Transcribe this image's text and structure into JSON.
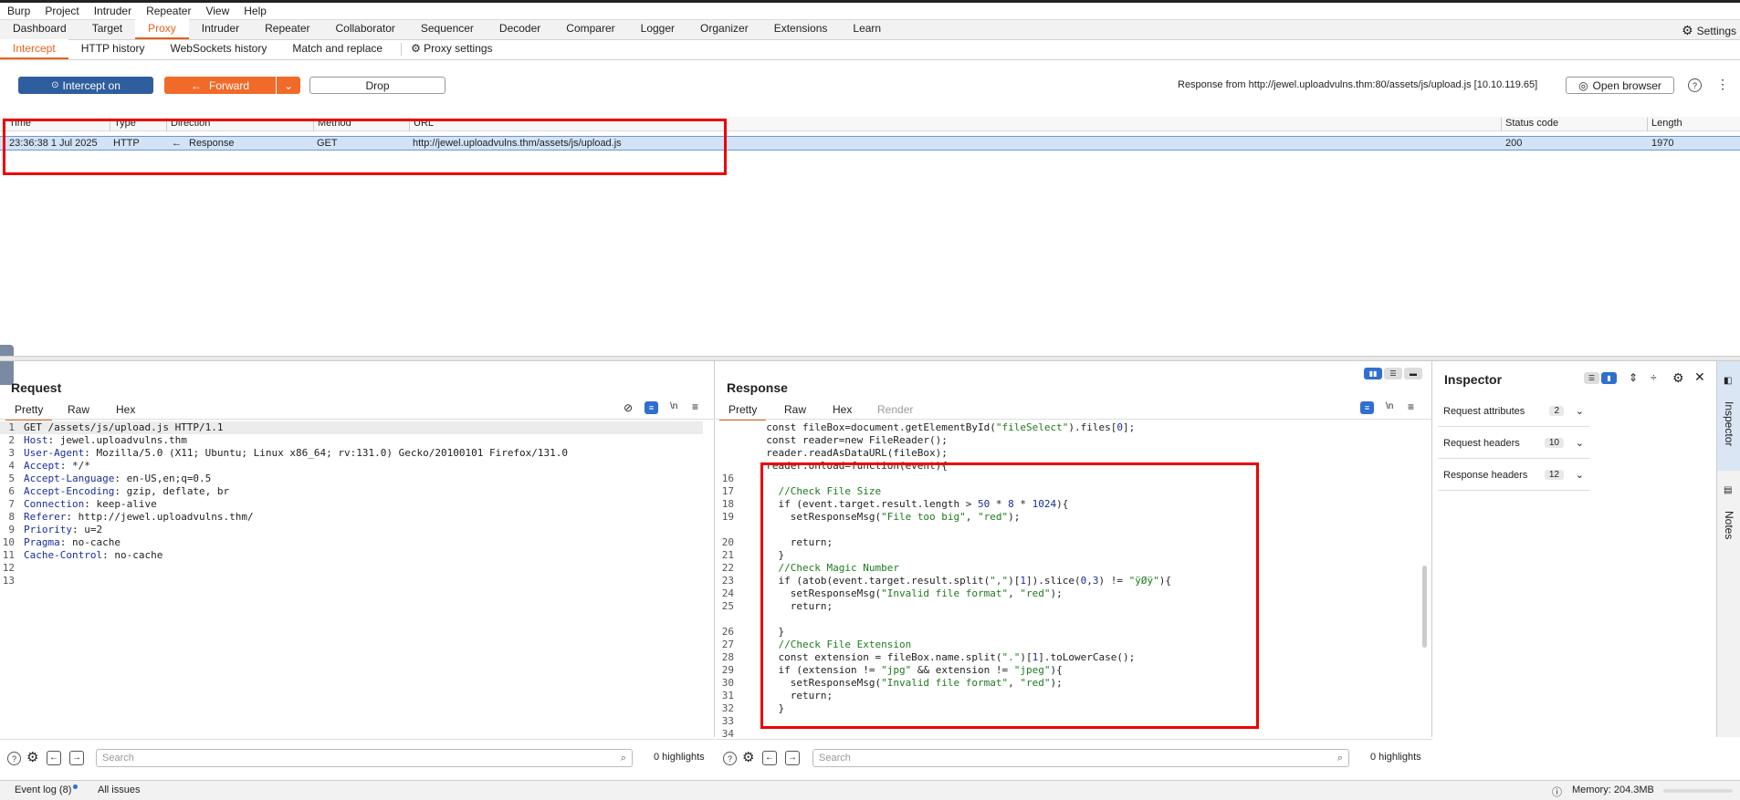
{
  "menu": [
    "Burp",
    "Project",
    "Intruder",
    "Repeater",
    "View",
    "Help"
  ],
  "main_tabs": [
    "Dashboard",
    "Target",
    "Proxy",
    "Intruder",
    "Repeater",
    "Collaborator",
    "Sequencer",
    "Decoder",
    "Comparer",
    "Logger",
    "Organizer",
    "Extensions",
    "Learn"
  ],
  "settings_label": "Settings",
  "proxy_tabs": [
    "Intercept",
    "HTTP history",
    "WebSockets history",
    "Match and replace"
  ],
  "proxy_settings_label": "Proxy settings",
  "toolbar": {
    "intercept_label": "Intercept on",
    "forward_label": "Forward",
    "drop_label": "Drop",
    "response_from": "Response from http://jewel.uploadvulns.thm:80/assets/js/upload.js  [10.10.119.65]",
    "open_browser_label": "Open browser"
  },
  "table": {
    "headers": [
      "Time",
      "Type",
      "Direction",
      "Method",
      "URL",
      "Status code",
      "Length"
    ],
    "row": {
      "time": "23:36:38 1 Jul 2025",
      "type": "HTTP",
      "direction": "Response",
      "method": "GET",
      "url": "http://jewel.uploadvulns.thm/assets/js/upload.js",
      "status": "200",
      "length": "1970"
    }
  },
  "request": {
    "title": "Request",
    "tabs": [
      "Pretty",
      "Raw",
      "Hex"
    ],
    "lines": [
      [
        "",
        "GET /assets/js/upload.js HTTP/1.1"
      ],
      [
        "Host",
        ": jewel.uploadvulns.thm"
      ],
      [
        "User-Agent",
        ": Mozilla/5.0 (X11; Ubuntu; Linux x86_64; rv:131.0) Gecko/20100101 Firefox/131.0"
      ],
      [
        "Accept",
        ": */*"
      ],
      [
        "Accept-Language",
        ": en-US,en;q=0.5"
      ],
      [
        "Accept-Encoding",
        ": gzip, deflate, br"
      ],
      [
        "Connection",
        ": keep-alive"
      ],
      [
        "Referer",
        ": http://jewel.uploadvulns.thm/"
      ],
      [
        "Priority",
        ": u=2"
      ],
      [
        "Pragma",
        ": no-cache"
      ],
      [
        "Cache-Control",
        ": no-cache"
      ],
      [
        "",
        ""
      ],
      [
        "",
        ""
      ]
    ],
    "search_placeholder": "Search",
    "highlights": "0 highlights"
  },
  "response": {
    "title": "Response",
    "tabs": [
      "Pretty",
      "Raw",
      "Hex",
      "Render"
    ],
    "line_numbers": [
      "",
      "",
      "",
      "",
      "16",
      "17",
      "18",
      "19",
      "",
      "20",
      "21",
      "22",
      "23",
      "24",
      "25",
      "",
      "26",
      "27",
      "28",
      "29",
      "30",
      "31",
      "32",
      "33",
      "34"
    ],
    "lines": [
      "  const fileBox=document.getElementById(\"fileSelect\").files[0];",
      "  const reader=new FileReader();",
      "  reader.readAsDataURL(fileBox);",
      "  reader.onload=function(event){",
      "",
      "    //Check File Size",
      "    if (event.target.result.length > 50 * 8 * 1024){",
      "      setResponseMsg(\"File too big\", \"red\");",
      "",
      "      return;",
      "    }",
      "    //Check Magic Number",
      "    if (atob(event.target.result.split(\",\")[1]).slice(0,3) != \"ÿØÿ\"){",
      "      setResponseMsg(\"Invalid file format\", \"red\");",
      "      return;",
      "",
      "    }",
      "    //Check File Extension",
      "    const extension = fileBox.name.split(\".\")[1].toLowerCase();",
      "    if (extension != \"jpg\" && extension != \"jpeg\"){",
      "      setResponseMsg(\"Invalid file format\", \"red\");",
      "      return;",
      "    }",
      "",
      ""
    ],
    "search_placeholder": "Search",
    "highlights": "0 highlights"
  },
  "inspector": {
    "title": "Inspector",
    "sections": [
      {
        "label": "Request attributes",
        "count": "2"
      },
      {
        "label": "Request headers",
        "count": "10"
      },
      {
        "label": "Response headers",
        "count": "12"
      }
    ],
    "side_tabs": [
      "Inspector",
      "Notes"
    ]
  },
  "statusbar": {
    "event_log": "Event log (8)",
    "all_issues": "All issues",
    "memory": "Memory: 204.3MB"
  },
  "colors": {
    "accent": "#e8601c",
    "intercept": "#2f5e9e",
    "highlight": "#e00000"
  }
}
